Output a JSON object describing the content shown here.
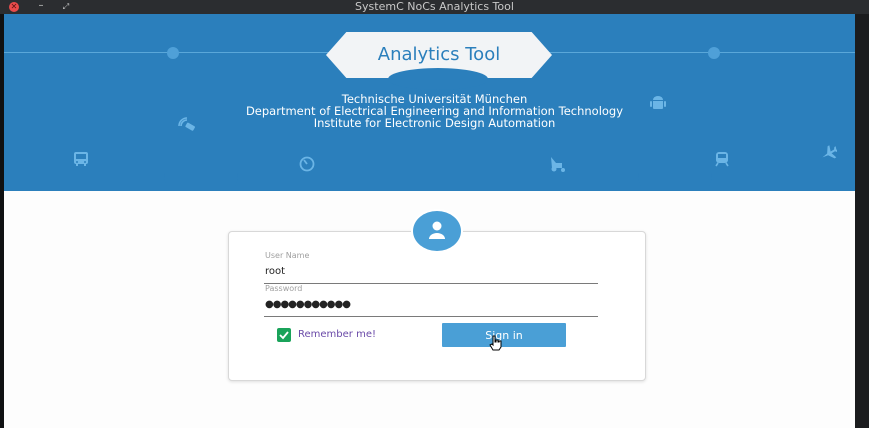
{
  "window": {
    "title": "SystemC NoCs Analytics Tool",
    "close_glyph": "✕",
    "min_glyph": "–",
    "max_glyph": "⤢"
  },
  "header": {
    "app_title": "Analytics Tool",
    "institution_lines": [
      "Technische Universität München",
      "Department of Electrical Engineering and Information Technology",
      "Institute for Electronic Design Automation"
    ],
    "icons": [
      "satellite-icon",
      "android-icon",
      "bus-icon",
      "timer-icon",
      "harvester-icon",
      "train-icon",
      "airplane-icon"
    ]
  },
  "login": {
    "username_label": "User Name",
    "username_value": "root",
    "password_label": "Password",
    "password_value": "●●●●●●●●●●●",
    "remember_label": "Remember me!",
    "remember_checked": true,
    "signin_label": "Sign in"
  },
  "colors": {
    "header_blue": "#2b7fbc",
    "accent_blue": "#4a9fd6",
    "checkbox_green": "#1aa35a"
  }
}
